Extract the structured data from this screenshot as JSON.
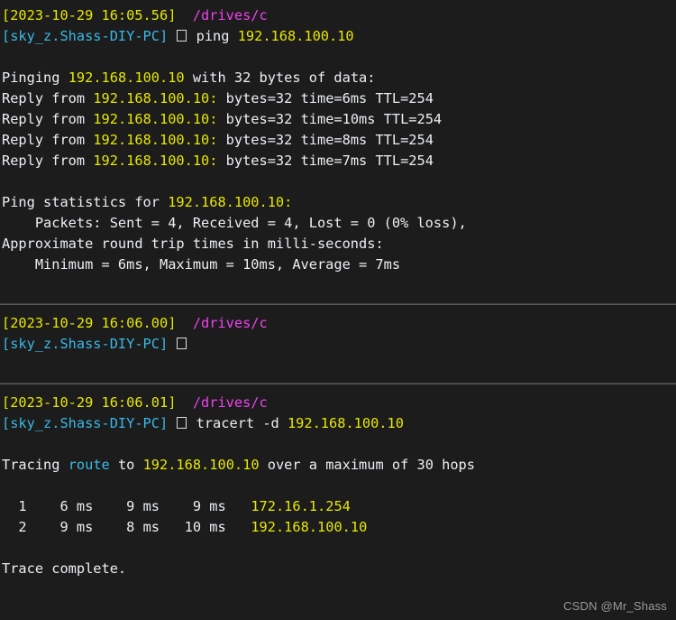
{
  "terminal": {
    "background_color": "#1c1c1c",
    "colors": {
      "default_text": "#eceff4",
      "timestamp": "#e8e800",
      "ip_address": "#e8e800",
      "hostname": "#39b9e6",
      "path": "#f042f0",
      "keyword": "#39b9e6",
      "separator": "#5a5a5a",
      "watermark": "#9a9a9a"
    },
    "prompt_glyph": "tofu-box"
  },
  "blocks": [
    {
      "prompt": {
        "timestamp": "[2023-10-29 16:05.56]",
        "path": "/drives/c",
        "user_host": "[sky_z.Shass-DIY-PC]",
        "command_name": "ping",
        "command_arg": "192.168.100.10"
      },
      "output": {
        "pinging_prefix": "Pinging ",
        "pinging_target": "192.168.100.10",
        "pinging_suffix": " with 32 bytes of data:",
        "replies": [
          {
            "prefix": "Reply from ",
            "ip": "192.168.100.10:",
            "detail": " bytes=32 time=6ms TTL=254"
          },
          {
            "prefix": "Reply from ",
            "ip": "192.168.100.10:",
            "detail": " bytes=32 time=10ms TTL=254"
          },
          {
            "prefix": "Reply from ",
            "ip": "192.168.100.10:",
            "detail": " bytes=32 time=8ms TTL=254"
          },
          {
            "prefix": "Reply from ",
            "ip": "192.168.100.10:",
            "detail": " bytes=32 time=7ms TTL=254"
          }
        ],
        "stats_prefix": "Ping statistics for ",
        "stats_ip": "192.168.100.10:",
        "packets_line": "    Packets: Sent = 4, Received = 4, Lost = 0 (0% loss),",
        "approx_line": "Approximate round trip times in milli-seconds:",
        "minmax_line": "    Minimum = 6ms, Maximum = 10ms, Average = 7ms"
      }
    },
    {
      "prompt": {
        "timestamp": "[2023-10-29 16:06.00]",
        "path": "/drives/c",
        "user_host": "[sky_z.Shass-DIY-PC]",
        "command_name": "",
        "command_arg": ""
      }
    },
    {
      "prompt": {
        "timestamp": "[2023-10-29 16:06.01]",
        "path": "/drives/c",
        "user_host": "[sky_z.Shass-DIY-PC]",
        "command_name": "tracert -d",
        "command_arg": "192.168.100.10"
      },
      "output": {
        "tracing_prefix": "Tracing ",
        "tracing_keyword": "route",
        "tracing_middle": " to ",
        "tracing_target": "192.168.100.10",
        "tracing_suffix": " over a maximum of 30 hops",
        "hops": [
          {
            "index": "  1",
            "t1": "    6 ms",
            "t2": "    9 ms",
            "t3": "    9 ms",
            "host": "172.16.1.254"
          },
          {
            "index": "  2",
            "t1": "    9 ms",
            "t2": "    8 ms",
            "t3": "   10 ms",
            "host": "192.168.100.10"
          }
        ],
        "trace_complete": "Trace complete."
      }
    }
  ],
  "watermark": "CSDN @Mr_Shass"
}
